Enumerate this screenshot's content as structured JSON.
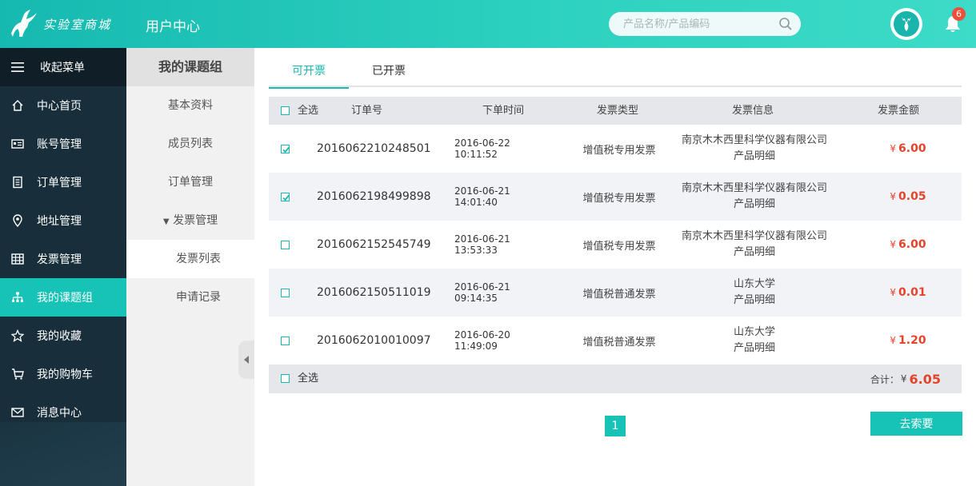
{
  "header": {
    "logo_text": "实验室商城",
    "page_title": "用户中心",
    "search_placeholder": "产品名称/产品编码",
    "notification_count": "6"
  },
  "sidebar": {
    "collapse_label": "收起菜单",
    "items": [
      {
        "label": "中心首页",
        "icon": "home-icon"
      },
      {
        "label": "账号管理",
        "icon": "id-card-icon"
      },
      {
        "label": "订单管理",
        "icon": "document-icon"
      },
      {
        "label": "地址管理",
        "icon": "location-pin-icon"
      },
      {
        "label": "发票管理",
        "icon": "grid-table-icon"
      },
      {
        "label": "我的课题组",
        "icon": "org-chart-icon",
        "active": true
      },
      {
        "label": "我的收藏",
        "icon": "star-icon"
      },
      {
        "label": "我的购物车",
        "icon": "cart-icon"
      },
      {
        "label": "消息中心",
        "icon": "envelope-icon"
      }
    ]
  },
  "submenu": {
    "title": "我的课题组",
    "items": [
      {
        "label": "基本资料"
      },
      {
        "label": "成员列表"
      },
      {
        "label": "订单管理"
      },
      {
        "label": "发票管理",
        "expanded": true
      },
      {
        "label": "发票列表",
        "selected": true
      },
      {
        "label": "申请记录"
      }
    ]
  },
  "tabs": [
    {
      "label": "可开票",
      "active": true
    },
    {
      "label": "已开票"
    }
  ],
  "table": {
    "select_all_label": "全选",
    "headers": [
      "订单号",
      "下单时间",
      "发票类型",
      "发票信息",
      "发票金额"
    ],
    "currency": "¥",
    "rows": [
      {
        "checked": true,
        "order_no": "2016062210248501",
        "time": "2016-06-22 10:11:52",
        "type": "增值税专用发票",
        "info_line1": "南京木木西里科学仪器有限公司",
        "info_line2": "产品明细",
        "amount": "6.00"
      },
      {
        "checked": true,
        "order_no": "2016062198499898",
        "time": "2016-06-21 14:01:40",
        "type": "增值税专用发票",
        "info_line1": "南京木木西里科学仪器有限公司",
        "info_line2": "产品明细",
        "amount": "0.05"
      },
      {
        "checked": false,
        "order_no": "2016062152545749",
        "time": "2016-06-21 13:53:33",
        "type": "增值税专用发票",
        "info_line1": "南京木木西里科学仪器有限公司",
        "info_line2": "产品明细",
        "amount": "6.00"
      },
      {
        "checked": false,
        "order_no": "2016062150511019",
        "time": "2016-06-21 09:14:35",
        "type": "增值税普通发票",
        "info_line1": "山东大学",
        "info_line2": "产品明细",
        "amount": "0.01"
      },
      {
        "checked": false,
        "order_no": "2016062010010097",
        "time": "2016-06-20 11:49:09",
        "type": "增值税普通发票",
        "info_line1": "山东大学",
        "info_line2": "产品明细",
        "amount": "1.20"
      }
    ],
    "footer_select_all": "全选",
    "total_label": "合计：",
    "total_currency": "¥",
    "total_amount": "6.05"
  },
  "pagination": {
    "current_page": "1"
  },
  "actions": {
    "request_button": "去索要"
  },
  "colors": {
    "accent": "#17c3b7",
    "sidebar_bg": "#182f3b",
    "amount_red": "#e5432c"
  }
}
